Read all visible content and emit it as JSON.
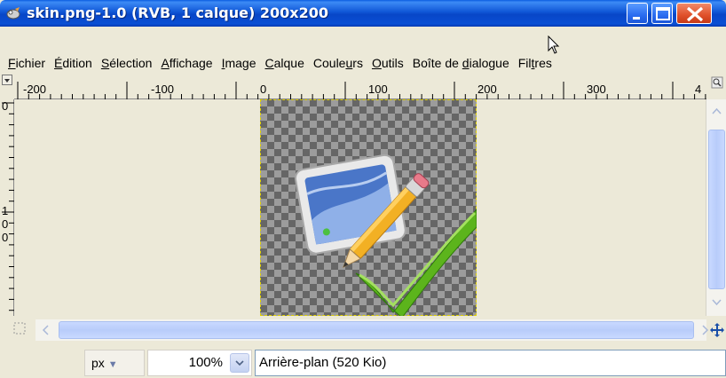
{
  "window": {
    "title": "skin.png-1.0 (RVB, 1 calque) 200x200",
    "title_color": "#0a4fd4",
    "icon": "gimp-wilber-icon"
  },
  "menu": [
    {
      "label": "Fichier",
      "mnemonic": "F"
    },
    {
      "label": "Édition",
      "mnemonic": "É"
    },
    {
      "label": "Sélection",
      "mnemonic": "S"
    },
    {
      "label": "Affichage",
      "mnemonic": "A"
    },
    {
      "label": "Image",
      "mnemonic": "I"
    },
    {
      "label": "Calque",
      "mnemonic": "C"
    },
    {
      "label": "Couleurs",
      "mnemonic": "u"
    },
    {
      "label": "Outils",
      "mnemonic": "O"
    },
    {
      "label": "Boîte de dialogue",
      "mnemonic": "d"
    },
    {
      "label": "Filtres",
      "mnemonic": "t"
    }
  ],
  "ruler": {
    "horizontal_labels": [
      "-200",
      "-100",
      "0",
      "100",
      "200",
      "300",
      "4"
    ],
    "vertical_labels": [
      "0",
      "1",
      "0",
      "0"
    ]
  },
  "status": {
    "unit": "px",
    "zoom": "100%",
    "layer_info": "Arrière-plan (520 Kio)"
  }
}
